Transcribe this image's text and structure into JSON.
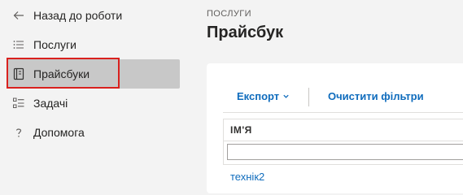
{
  "sidebar": {
    "items": [
      {
        "label": "Назад до роботи",
        "icon": "arrow-left-icon"
      },
      {
        "label": "Послуги",
        "icon": "list-icon"
      },
      {
        "label": "Прайсбуки",
        "icon": "book-icon",
        "selected": true
      },
      {
        "label": "Задачі",
        "icon": "task-list-icon"
      },
      {
        "label": "Допомога",
        "icon": "question-icon"
      }
    ]
  },
  "header": {
    "breadcrumb": "ПОСЛУГИ",
    "title": "Прайсбук"
  },
  "toolbar": {
    "export_label": "Експорт",
    "clear_filters_label": "Очистити фільтри"
  },
  "table": {
    "columns": [
      "ІМ'Я"
    ],
    "filter_value": "",
    "rows": [
      {
        "name": "технік2"
      }
    ]
  },
  "colors": {
    "accent": "#0f6cbd",
    "highlight": "#d9211e",
    "selected_bg": "#c8c8c8"
  }
}
